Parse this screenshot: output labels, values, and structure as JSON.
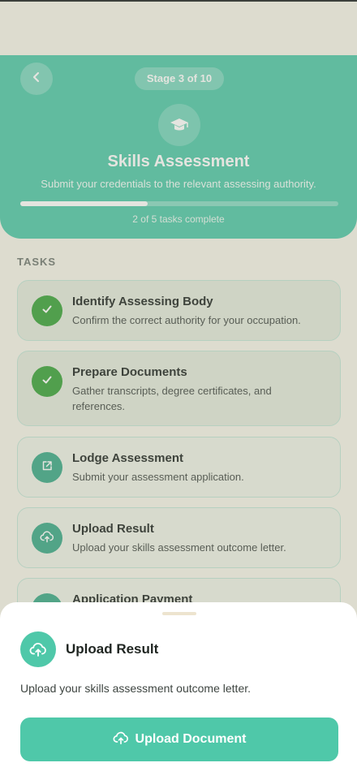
{
  "header": {
    "stage_label": "Stage 3 of 10",
    "title": "Skills Assessment",
    "subtitle": "Submit your credentials to the relevant assessing authority.",
    "progress_text": "2 of 5 tasks complete",
    "progress_fraction": 0.4
  },
  "section_label": "TASKS",
  "tasks": [
    {
      "title": "Identify Assessing Body",
      "desc": "Confirm the correct authority for your occupation.",
      "status": "done",
      "icon": "check-icon"
    },
    {
      "title": "Prepare Documents",
      "desc": "Gather transcripts, degree certificates, and references.",
      "status": "done",
      "icon": "check-icon"
    },
    {
      "title": "Lodge Assessment",
      "desc": "Submit your assessment application.",
      "status": "pending",
      "icon": "external-link-icon"
    },
    {
      "title": "Upload Result",
      "desc": "Upload your skills assessment outcome letter.",
      "status": "pending",
      "icon": "cloud-upload-icon"
    },
    {
      "title": "Application Payment",
      "desc": "",
      "status": "pending",
      "icon": "payment-icon"
    }
  ],
  "sheet": {
    "title": "Upload Result",
    "description": "Upload your skills assessment outcome letter.",
    "button_label": "Upload Document"
  },
  "colors": {
    "accent": "#4fc8a9",
    "done": "#39a23a",
    "background": "#f6f4ea"
  }
}
